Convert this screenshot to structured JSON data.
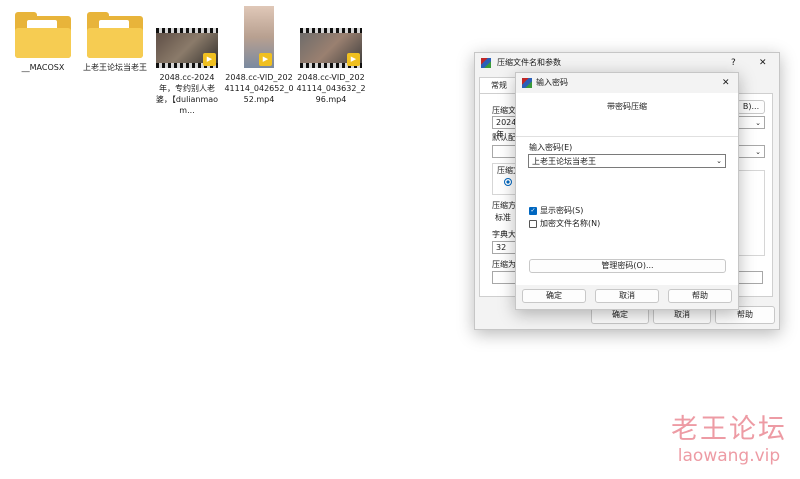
{
  "desktop": {
    "files": [
      {
        "name": "__MACOSX",
        "kind": "folder"
      },
      {
        "name": "上老王论坛当老王",
        "kind": "folder"
      },
      {
        "name": "2048.cc-2024年，专约别人老婆，【dulianmaom...",
        "kind": "video"
      },
      {
        "name": "2048.cc-VID_20241114_042652_052.mp4",
        "kind": "video"
      },
      {
        "name": "2048.cc-VID_20241114_043632_296.mp4",
        "kind": "video"
      }
    ]
  },
  "archive_dialog": {
    "title": "压缩文件名和参数",
    "help_icon": "?",
    "close_icon": "✕",
    "tab_general": "常规",
    "label_archive_name": "压缩文",
    "archive_name_value": "2024年",
    "browse_button": "B)...",
    "label_default_profile": "默认配",
    "label_format": "压缩文",
    "label_method": "压缩方",
    "method_value": "标准",
    "label_dict": "字典大",
    "dict_value": "32",
    "label_split": "压缩为",
    "ok_button": "确定",
    "cancel_button": "取消",
    "help_button": "帮助"
  },
  "password_dialog": {
    "title": "输入密码",
    "close_icon": "✕",
    "heading": "带密码压缩",
    "label_enter_password": "输入密码(E)",
    "password_value": "上老王论坛当老王",
    "show_password_label": "显示密码(S)",
    "show_password_checked": true,
    "encrypt_names_label": "加密文件名称(N)",
    "encrypt_names_checked": false,
    "manage_button": "管理密码(O)...",
    "ok_button": "确定",
    "cancel_button": "取消",
    "help_button": "帮助"
  },
  "watermark": {
    "line1": "老王论坛",
    "line2": "laowang.vip"
  },
  "colors": {
    "accent": "#0067c0",
    "folder": "#f6cc52",
    "watermark": "#e04a5a"
  }
}
